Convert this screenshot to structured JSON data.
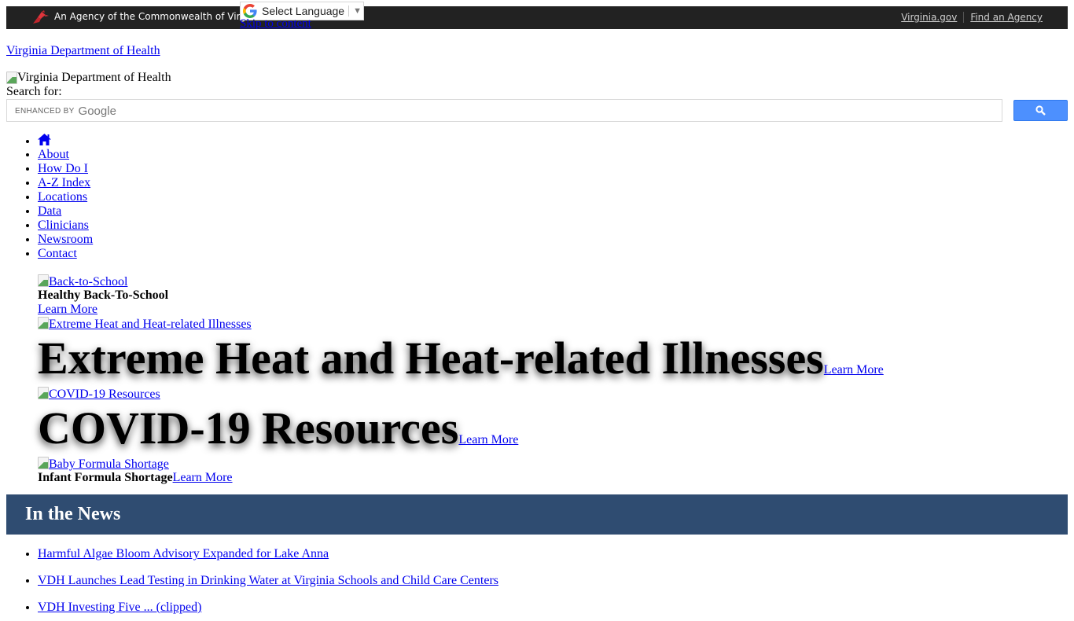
{
  "topbar": {
    "agency_text": "An Agency of the Commonwealth of Virginia",
    "logo_icon": "cardinal-icon",
    "links": [
      {
        "label": "Virginia.gov"
      },
      {
        "label": "Find an Agency"
      }
    ],
    "background": "#222222"
  },
  "translate": {
    "icon": "google-g-icon",
    "label": "Select Language",
    "caret": "▼"
  },
  "skip_link": "Skip to content",
  "site_link": "Virginia Department of Health",
  "logo_alt": "Virginia Department of Health",
  "search": {
    "label": "Search for:",
    "enhanced_by": "ENHANCED BY",
    "google": "Google",
    "button_icon": "search-icon",
    "button_color": "#4d90fe"
  },
  "nav": {
    "home_icon": "home-icon",
    "items": [
      "About",
      "How Do I",
      "A-Z Index",
      "Locations",
      "Data",
      "Clinicians",
      "Newsroom",
      "Contact"
    ]
  },
  "slides": [
    {
      "image_alt": "Back-to-School",
      "title": "Healthy Back-To-School",
      "cta": "Learn More"
    },
    {
      "image_alt": "Extreme Heat and Heat-related Illnesses",
      "title": "Extreme Heat and Heat-related Illnesses",
      "cta": "Learn More"
    },
    {
      "image_alt": "COVID-19 Resources",
      "title": "COVID-19 Resources",
      "cta": "Learn More"
    },
    {
      "image_alt": "Baby Formula Shortage",
      "title": "Infant Formula Shortage",
      "cta": "Learn More"
    }
  ],
  "news": {
    "heading": "In the News",
    "header_color": "#2f4c71",
    "items": [
      "Harmful Algae Bloom Advisory Expanded for Lake Anna",
      "VDH Launches Lead Testing in Drinking Water at Virginia Schools and Child Care Centers",
      "VDH Investing Five ... (clipped)"
    ]
  }
}
